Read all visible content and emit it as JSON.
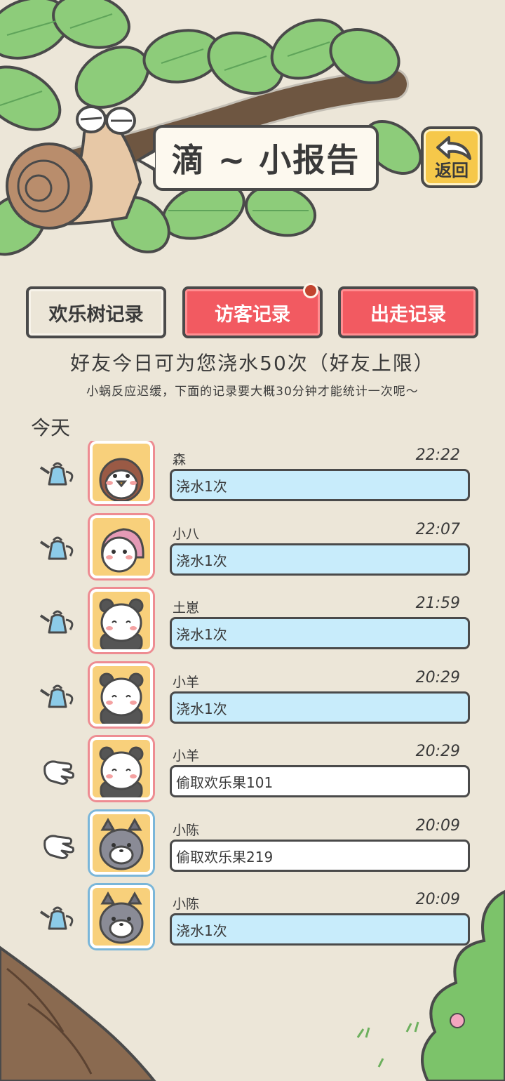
{
  "header": {
    "title": "滴 ~ 小报告",
    "back_label": "返回"
  },
  "tabs": [
    {
      "label": "欢乐树记录"
    },
    {
      "label": "访客记录"
    },
    {
      "label": "出走记录"
    }
  ],
  "info": {
    "main": "好友今日可为您浇水50次（好友上限）",
    "sub": "小蜗反应迟缓，下面的记录要大概30分钟才能统计一次呢～"
  },
  "section_label": "今天",
  "records": [
    {
      "name": "森",
      "time": "22:22",
      "action": "浇水1次",
      "type": "water",
      "avatar": "penguin",
      "frame": "pink"
    },
    {
      "name": "小八",
      "time": "22:07",
      "action": "浇水1次",
      "type": "water",
      "avatar": "hedgehog",
      "frame": "pink"
    },
    {
      "name": "土崽",
      "time": "21:59",
      "action": "浇水1次",
      "type": "water",
      "avatar": "panda",
      "frame": "pink"
    },
    {
      "name": "小羊",
      "time": "20:29",
      "action": "浇水1次",
      "type": "water",
      "avatar": "panda",
      "frame": "pink"
    },
    {
      "name": "小羊",
      "time": "20:29",
      "action": "偷取欢乐果101",
      "type": "steal",
      "avatar": "panda",
      "frame": "pink"
    },
    {
      "name": "小陈",
      "time": "20:09",
      "action": "偷取欢乐果219",
      "type": "steal",
      "avatar": "raccoon",
      "frame": "blue"
    },
    {
      "name": "小陈",
      "time": "20:09",
      "action": "浇水1次",
      "type": "water",
      "avatar": "raccoon",
      "frame": "blue"
    }
  ],
  "colors": {
    "background": "#ece6d8",
    "tab_active": "#f25a61",
    "water_bar": "#c8ecfb",
    "back_button": "#f6c84a"
  }
}
